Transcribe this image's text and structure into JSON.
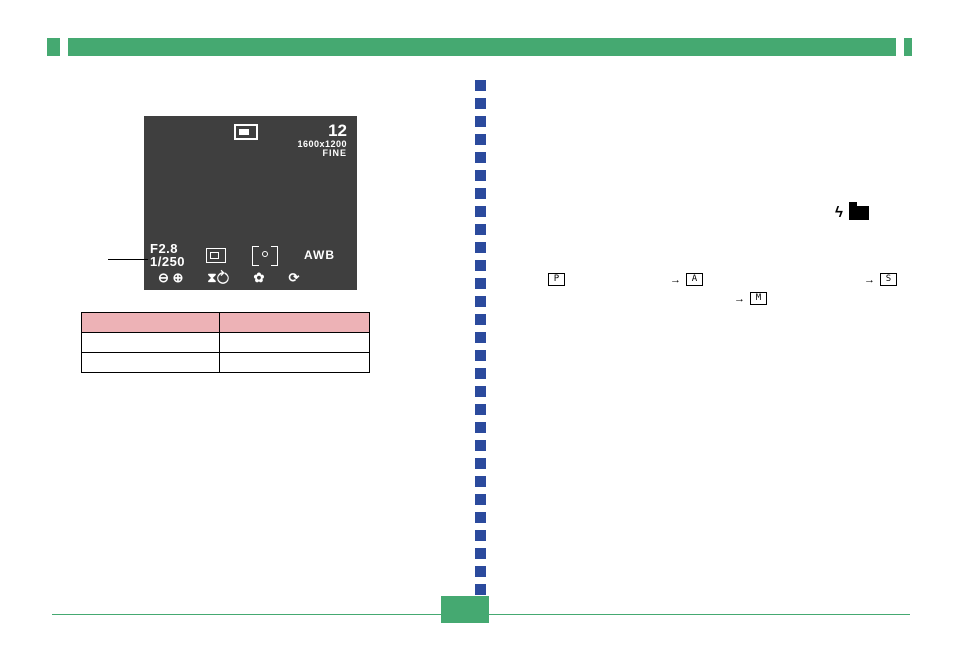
{
  "header": {
    "title": ""
  },
  "lcd": {
    "shots_remaining": "12",
    "resolution": "1600x1200",
    "quality": "FINE",
    "aperture": "F2.8",
    "shutter": "1/250",
    "wb": "AWB",
    "bottom_glyphs": {
      "zoom": "⊖ ⊕",
      "flash": "⧗⥁",
      "macro": "✿",
      "timer": "⟳"
    }
  },
  "table": {
    "headers": [
      "",
      ""
    ],
    "rows": [
      [
        "",
        ""
      ],
      [
        "",
        ""
      ]
    ]
  },
  "right_side": {
    "flash_label": "ϟ",
    "modes": {
      "p": "P",
      "a": "A",
      "s": "S",
      "m": "M"
    },
    "arrow": "→"
  },
  "colors": {
    "accent": "#45a971",
    "divider": "#2b4a9d",
    "table_header": "#edb2b6",
    "lcd_bg": "#3f3f3f"
  }
}
